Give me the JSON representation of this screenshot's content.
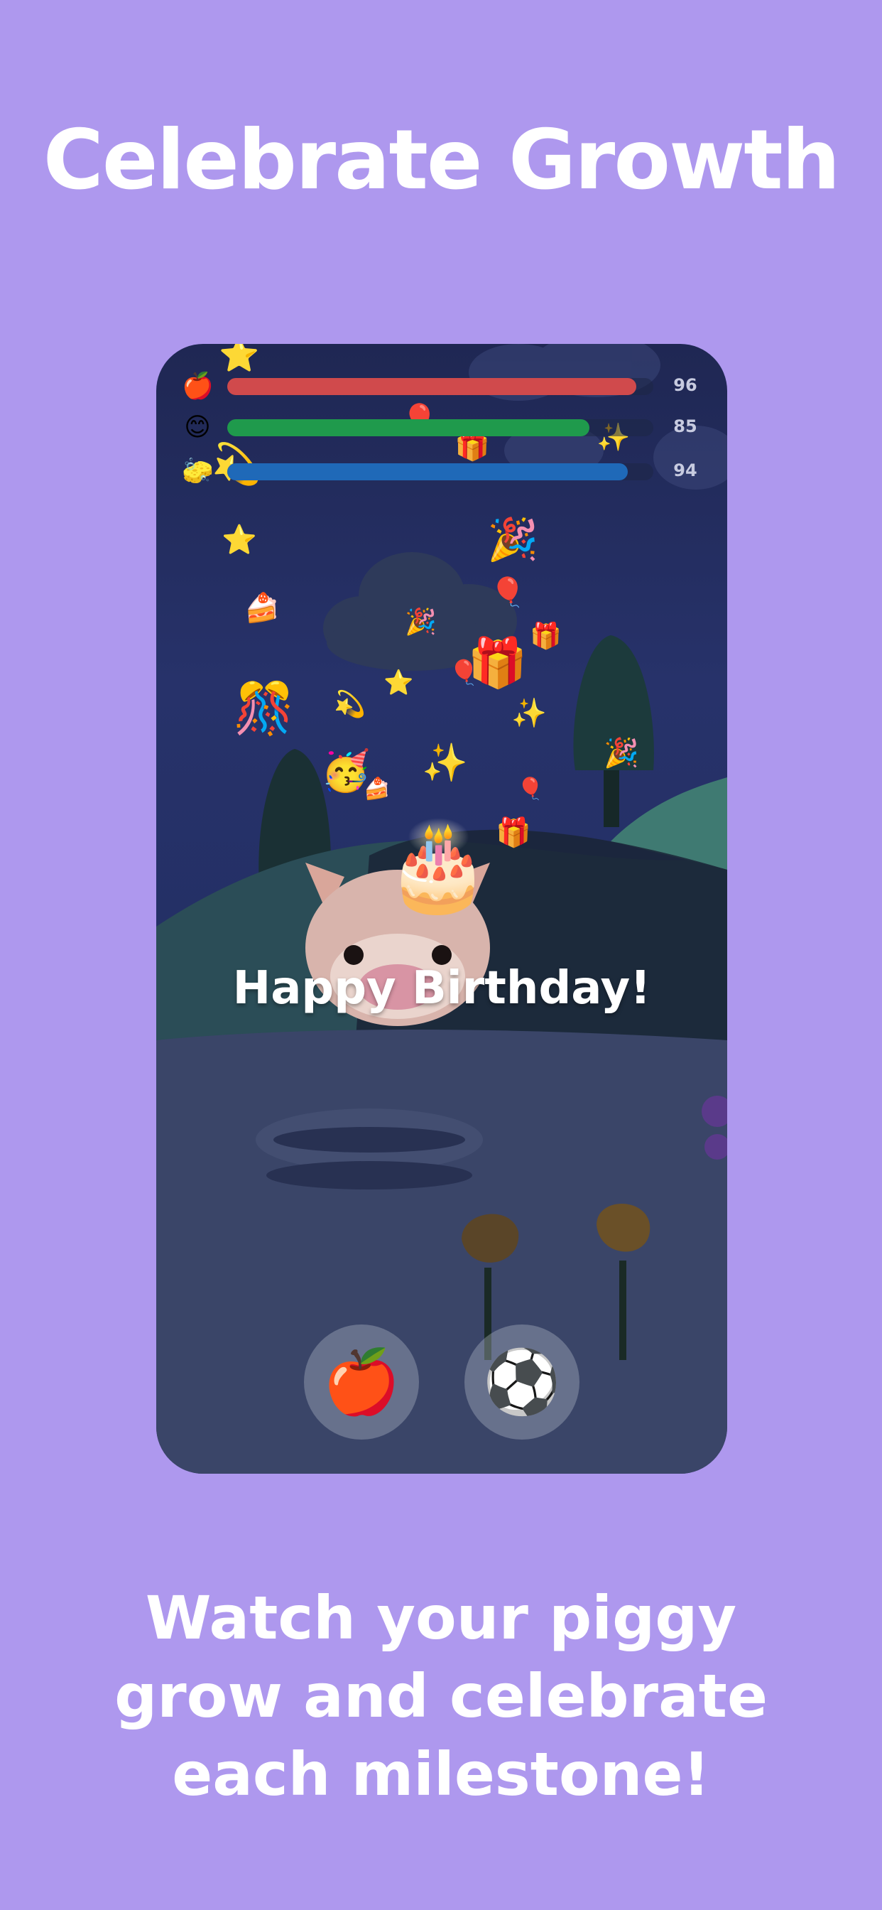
{
  "headline": "Celebrate Growth",
  "caption": "Watch your piggy grow and celebrate each milestone!",
  "game": {
    "stats": [
      {
        "icon": "apple-icon",
        "glyph": "🍎",
        "value": 96,
        "label": "96",
        "level": 0.96,
        "color": "#d04a4c"
      },
      {
        "icon": "smiley-icon",
        "glyph": "😊",
        "value": 85,
        "label": "85",
        "level": 0.85,
        "color": "#1f9a4c"
      },
      {
        "icon": "sponge-icon",
        "glyph": "🧽",
        "value": 94,
        "label": "94",
        "level": 0.94,
        "color": "#1f69b8"
      }
    ],
    "greeting": "Happy Birthday!",
    "actions": [
      {
        "name": "feed-apple-button",
        "icon": "apple-icon",
        "glyph": "🍎"
      },
      {
        "name": "play-ball-button",
        "icon": "soccer-ball-icon",
        "glyph": "⚽"
      }
    ]
  },
  "colors": {
    "background": "#ae98ee",
    "text": "#ffffff"
  }
}
